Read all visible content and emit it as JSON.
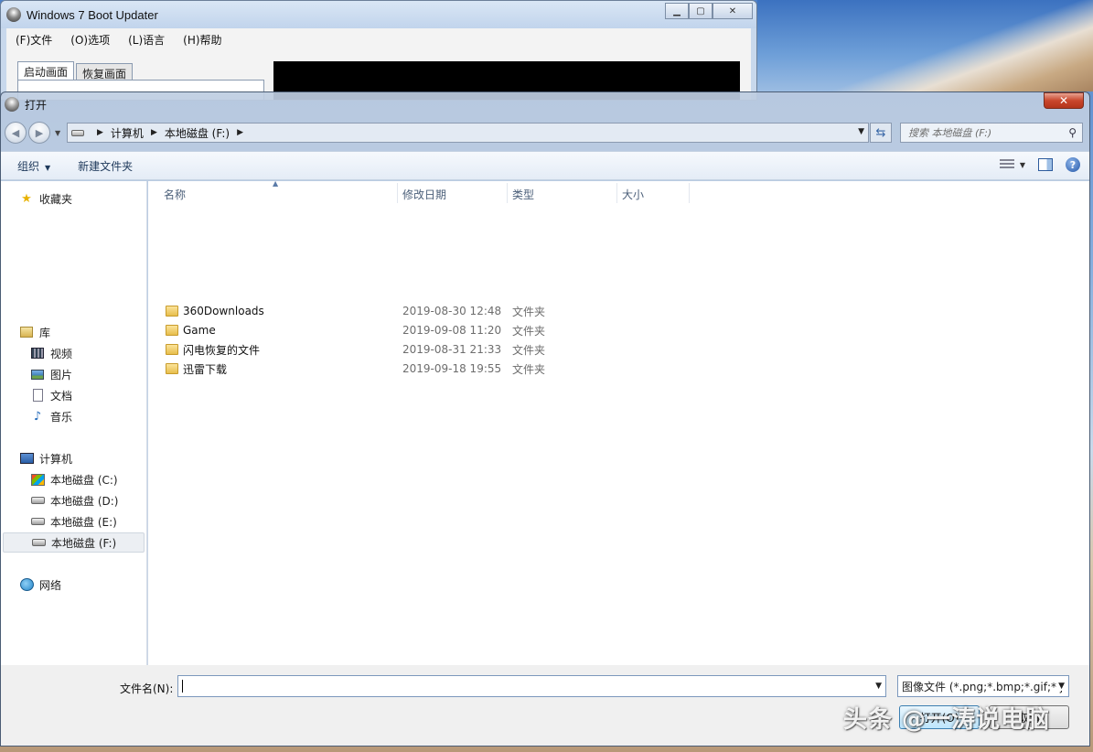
{
  "bg_app": {
    "title": "Windows 7 Boot Updater",
    "menu": [
      "(F)文件",
      "(O)选项",
      "(L)语言",
      "(H)帮助"
    ],
    "tabs": [
      "启动画面",
      "恢复画面"
    ]
  },
  "dialog": {
    "title": "打开",
    "close_glyph": "✕",
    "breadcrumb": [
      "计算机",
      "本地磁盘 (F:)"
    ],
    "search_placeholder": "搜索 本地磁盘 (F:)",
    "toolbar": {
      "organize": "组织",
      "new_folder": "新建文件夹"
    },
    "nav": {
      "favorites": "收藏夹",
      "libraries": "库",
      "lib_items": [
        "视频",
        "图片",
        "文档",
        "音乐"
      ],
      "computer": "计算机",
      "drives": [
        "本地磁盘 (C:)",
        "本地磁盘 (D:)",
        "本地磁盘 (E:)",
        "本地磁盘 (F:)"
      ],
      "network": "网络"
    },
    "columns": {
      "name": "名称",
      "date": "修改日期",
      "type": "类型",
      "size": "大小"
    },
    "files": [
      {
        "name": "360Downloads",
        "date": "2019-08-30 12:48",
        "type": "文件夹"
      },
      {
        "name": "Game",
        "date": "2019-09-08 11:20",
        "type": "文件夹"
      },
      {
        "name": "闪电恢复的文件",
        "date": "2019-08-31 21:33",
        "type": "文件夹"
      },
      {
        "name": "迅雷下载",
        "date": "2019-09-18 19:55",
        "type": "文件夹"
      }
    ],
    "file_name_label": "文件名(N):",
    "file_name_value": "",
    "filter": "图像文件 (*.png;*.bmp;*.gif;*.j",
    "open_label": "打开(O)",
    "cancel_label": "取消"
  },
  "watermark": "头条 @一涛说电脑",
  "colors": {
    "accent": "#1e395b",
    "selection": "#eceff3",
    "close_button": "#c9462c"
  }
}
